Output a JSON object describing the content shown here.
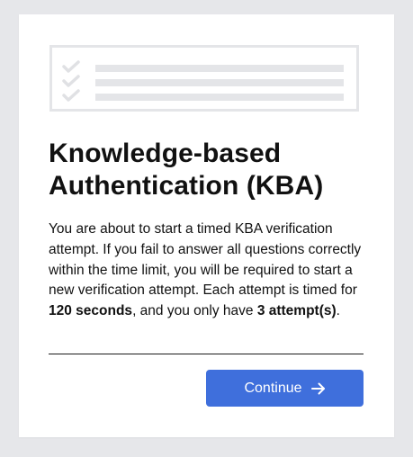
{
  "dialog": {
    "title": "Knowledge-based Authentication (KBA)",
    "description": {
      "part1": "You are about to start a timed KBA verification attempt. If you fail to answer all questions correctly within the time limit, you will be required to start a new verification attempt. Each attempt is timed for ",
      "time": "120 seconds",
      "part2": ", and you only have ",
      "attempts": "3 attempt(s)",
      "part3": "."
    },
    "continue_label": "Continue",
    "continue_icon": "arrow-right-icon",
    "illustration_icon": "checklist-icon"
  },
  "colors": {
    "page_background": "#e6e7ea",
    "card_background": "#ffffff",
    "accent": "#3f6fdc",
    "illustration": "#e4e5e8",
    "text": "#111111"
  }
}
